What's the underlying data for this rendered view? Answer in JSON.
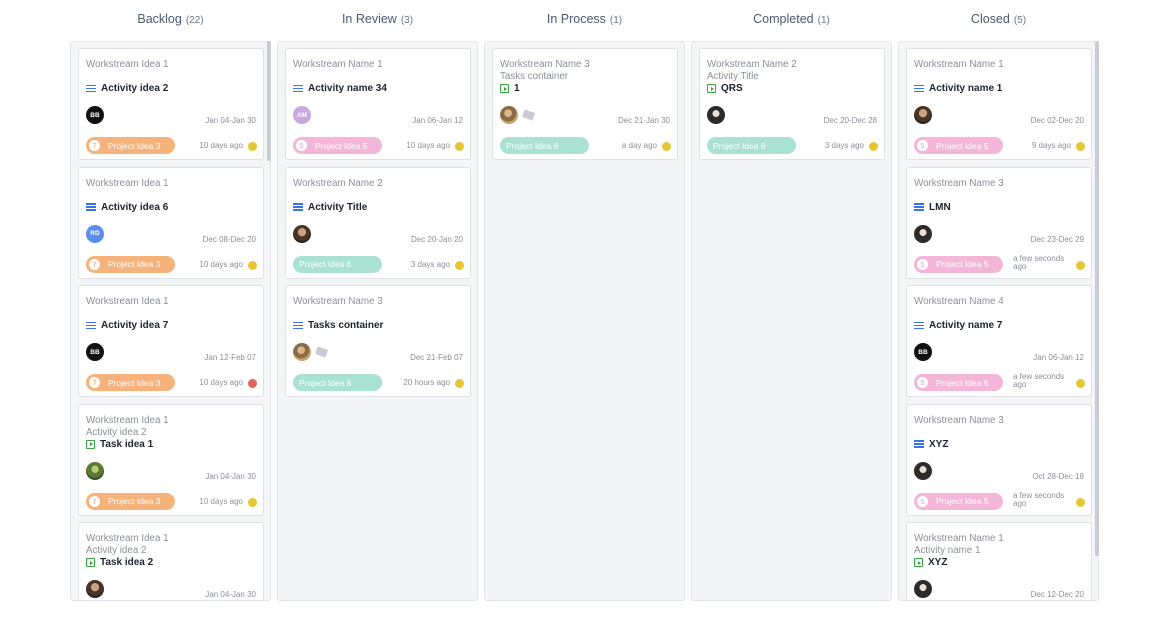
{
  "columns": [
    {
      "name": "Backlog",
      "count": "(22)",
      "cards": [
        {
          "workstream": "Workstream Idea 1",
          "sub": "",
          "title": "Activity idea 2",
          "kind": "activity",
          "avatar": "BB",
          "avatar_style": "bb",
          "dates": "Jan 04-Jan 30",
          "badge_num": "7",
          "badge": "Project Idea 3",
          "badge_color": "orange",
          "ago": "10 days ago",
          "dot": "yellow"
        },
        {
          "workstream": "Workstream Idea 1",
          "sub": "",
          "title": "Activity idea 6",
          "kind": "activity",
          "avatar": "RD",
          "avatar_style": "rd",
          "dates": "Dec 08-Dec 20",
          "badge_num": "7",
          "badge": "Project Idea 3",
          "badge_color": "orange",
          "ago": "10 days ago",
          "dot": "yellow"
        },
        {
          "workstream": "Workstream Idea 1",
          "sub": "",
          "title": "Activity idea 7",
          "kind": "activity",
          "avatar": "BB",
          "avatar_style": "bb",
          "dates": "Jan 12-Feb 07",
          "badge_num": "7",
          "badge": "Project Idea 3",
          "badge_color": "orange",
          "ago": "10 days ago",
          "dot": "red"
        },
        {
          "workstream": "Workstream Idea 1",
          "sub": "Activity idea 2",
          "title": "Task idea 1",
          "kind": "task",
          "avatar": "",
          "avatar_style": "leaf",
          "dates": "Jan 04-Jan 30",
          "badge_num": "7",
          "badge": "Project Idea 3",
          "badge_color": "orange",
          "ago": "10 days ago",
          "dot": "yellow"
        },
        {
          "workstream": "Workstream Idea 1",
          "sub": "Activity idea 2",
          "title": "Task idea 2",
          "kind": "task",
          "avatar": "",
          "avatar_style": "photo",
          "dates": "Jan 04-Jan 30",
          "badge_num": "",
          "badge": "",
          "badge_color": "",
          "ago": "",
          "dot": ""
        }
      ]
    },
    {
      "name": "In Review",
      "count": "(3)",
      "cards": [
        {
          "workstream": "Workstream Name 1",
          "sub": "",
          "title": "Activity name 34",
          "kind": "activity",
          "avatar": "AM",
          "avatar_style": "am",
          "dates": "Jan 06-Jan 12",
          "badge_num": "5",
          "badge": "Project Idea 5",
          "badge_color": "pink",
          "ago": "10 days ago",
          "dot": "yellow"
        },
        {
          "workstream": "Workstream Name 2",
          "sub": "",
          "title": "Activity Title",
          "kind": "activity",
          "avatar": "",
          "avatar_style": "photo",
          "dates": "Dec 20-Jan 20",
          "badge_num": "",
          "badge": "Project Idea 6",
          "badge_color": "teal",
          "ago": "3 days ago",
          "dot": "yellow"
        },
        {
          "workstream": "Workstream Name 3",
          "sub": "",
          "title": "Tasks container",
          "kind": "activity",
          "avatar": "",
          "avatar_style": "giraffe",
          "tag": true,
          "dates": "Dec 21-Feb 07",
          "badge_num": "",
          "badge": "Project Idea 6",
          "badge_color": "teal",
          "ago": "20 hours ago",
          "dot": "yellow"
        }
      ]
    },
    {
      "name": "In Process",
      "count": "(1)",
      "cards": [
        {
          "workstream": "Workstream Name 3",
          "sub": "Tasks container",
          "title": "1",
          "kind": "task",
          "avatar": "",
          "avatar_style": "giraffe",
          "tag": true,
          "dates": "Dec 21-Jan 30",
          "badge_num": "",
          "badge": "Project Idea 6",
          "badge_color": "teal",
          "ago": "a day ago",
          "dot": "yellow",
          "compact": true
        }
      ]
    },
    {
      "name": "Completed",
      "count": "(1)",
      "cards": [
        {
          "workstream": "Workstream Name 2",
          "sub": "Activity Title",
          "title": "QRS",
          "kind": "task",
          "avatar": "",
          "avatar_style": "photo2",
          "dates": "Dec 20-Dec 28",
          "badge_num": "",
          "badge": "Project Idea 6",
          "badge_color": "teal",
          "ago": "3 days ago",
          "dot": "yellow",
          "compact": true
        }
      ]
    },
    {
      "name": "Closed",
      "count": "(5)",
      "cards": [
        {
          "workstream": "Workstream Name 1",
          "sub": "",
          "title": "Activity name 1",
          "kind": "activity",
          "avatar": "",
          "avatar_style": "photo",
          "dates": "Dec 02-Dec 20",
          "badge_num": "5",
          "badge": "Project Idea 5",
          "badge_color": "pink",
          "ago": "9 days ago",
          "dot": "yellow"
        },
        {
          "workstream": "Workstream Name 3",
          "sub": "",
          "title": "LMN",
          "kind": "activity",
          "avatar": "",
          "avatar_style": "photo2",
          "dates": "Dec 23-Dec 29",
          "badge_num": "5",
          "badge": "Project Idea 5",
          "badge_color": "pink",
          "ago": "a few seconds ago",
          "dot": "yellow"
        },
        {
          "workstream": "Workstream Name 4",
          "sub": "",
          "title": "Activity name 7",
          "kind": "activity",
          "avatar": "BB",
          "avatar_style": "bb",
          "dates": "Jan 06-Jan 12",
          "badge_num": "5",
          "badge": "Project Idea 5",
          "badge_color": "pink",
          "ago": "a few seconds ago",
          "dot": "yellow"
        },
        {
          "workstream": "Workstream Name 3",
          "sub": "",
          "title": "XYZ",
          "kind": "activity",
          "avatar": "",
          "avatar_style": "photo2",
          "dates": "Oct 28-Dec 18",
          "badge_num": "5",
          "badge": "Project Idea 5",
          "badge_color": "pink",
          "ago": "a few seconds ago",
          "dot": "yellow"
        },
        {
          "workstream": "Workstream Name 1",
          "sub": "Activity name 1",
          "title": "XYZ",
          "kind": "task",
          "avatar": "",
          "avatar_style": "photo2",
          "dates": "Dec 12-Dec 20",
          "badge_num": "",
          "badge": "",
          "badge_color": "",
          "ago": "",
          "dot": ""
        }
      ]
    }
  ],
  "colors": {
    "orange": "#f5b27a",
    "teal": "#a9e2d3",
    "pink": "#f3b6d8",
    "dot_yellow": "#e3c733",
    "dot_red": "#e0645f",
    "list_icon": "#3b73e8",
    "task_icon": "#3aa244"
  }
}
